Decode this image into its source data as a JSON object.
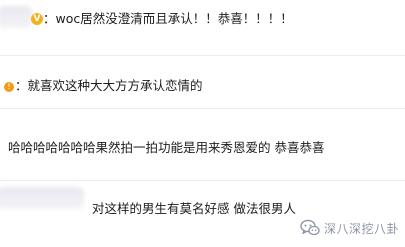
{
  "comments": [
    {
      "text": "：woc居然没澄清而且承认！！恭喜！！！！"
    },
    {
      "text": "：就喜欢这种大大方方承认恋情的"
    },
    {
      "text": "哈哈哈哈哈哈哈果然拍一拍功能是用来秀恩爱的 恭喜恭喜"
    },
    {
      "text": "对这样的男生有莫名好感 做法很男人"
    }
  ],
  "badges": {
    "vip": "V",
    "orange": "!"
  },
  "watermark": {
    "text": "深八深挖八卦",
    "icon": "wechat-icon"
  },
  "colors": {
    "text": "#1c1c1c",
    "divider": "#ececec",
    "vip_badge": "#f2b21c",
    "orange_badge": "#f49a1a",
    "watermark": "#8d95a3"
  }
}
